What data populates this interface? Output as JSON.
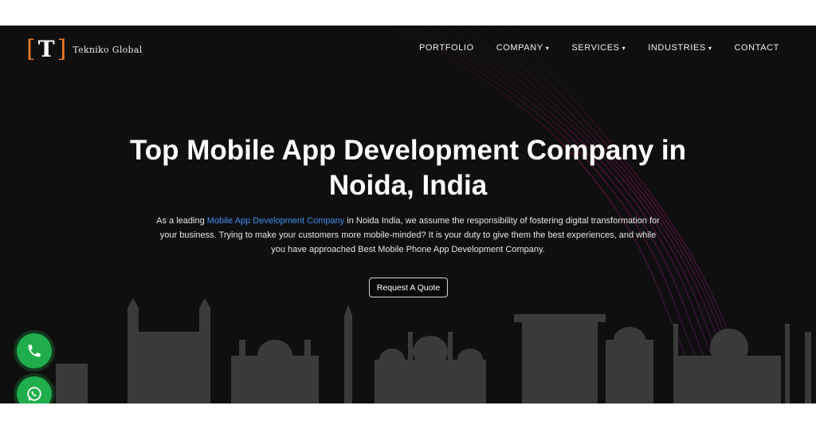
{
  "brand": {
    "mark_letter": "T",
    "name": "Tekniko Global",
    "accent": "#e87722"
  },
  "nav": {
    "items": [
      {
        "label": "PORTFOLIO",
        "dropdown": false
      },
      {
        "label": "COMPANY",
        "dropdown": true
      },
      {
        "label": "SERVICES",
        "dropdown": true
      },
      {
        "label": "INDUSTRIES",
        "dropdown": true
      },
      {
        "label": "CONTACT",
        "dropdown": false
      }
    ],
    "caret": "▾"
  },
  "hero": {
    "title_line1": "Top Mobile App Development Company in",
    "title_line2": "Noida, India",
    "desc_pre": "As a leading ",
    "desc_link": "Mobile App Development Company",
    "desc_post": " in Noida India, we assume the responsibility of fostering digital transformation for your business. Trying to make your customers more mobile-minded? It is your duty to give them the best experiences, and while you have approached Best Mobile Phone App Development Company.",
    "cta_label": "Request A Quote"
  },
  "floating": {
    "call_icon": "phone-icon",
    "whatsapp_icon": "whatsapp-icon",
    "color": "#1fae4b"
  }
}
